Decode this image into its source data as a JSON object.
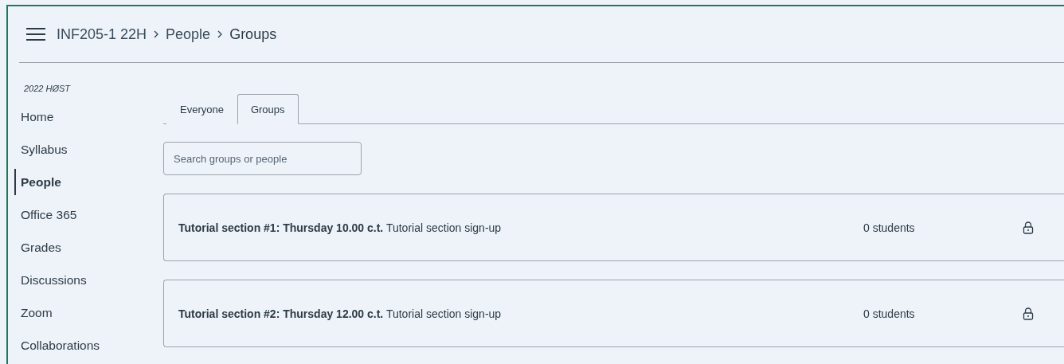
{
  "breadcrumb": [
    {
      "label": "INF205-1 22H",
      "current": false
    },
    {
      "label": "People",
      "current": false
    },
    {
      "label": "Groups",
      "current": true
    }
  ],
  "sidebar": {
    "term": "2022 HØST",
    "items": [
      {
        "label": "Home",
        "selected": false
      },
      {
        "label": "Syllabus",
        "selected": false
      },
      {
        "label": "People",
        "selected": true
      },
      {
        "label": "Office 365",
        "selected": false
      },
      {
        "label": "Grades",
        "selected": false
      },
      {
        "label": "Discussions",
        "selected": false
      },
      {
        "label": "Zoom",
        "selected": false
      },
      {
        "label": "Collaborations",
        "selected": false
      }
    ]
  },
  "tabs": [
    {
      "label": "Everyone",
      "selected": false
    },
    {
      "label": "Groups",
      "selected": true
    }
  ],
  "search": {
    "placeholder": "Search groups or people"
  },
  "groups": [
    {
      "name": "Tutorial section #1: Thursday 10.00 c.t.",
      "category": "Tutorial section sign-up",
      "count": "0 students",
      "locked": true
    },
    {
      "name": "Tutorial section #2: Thursday 12.00 c.t.",
      "category": "Tutorial section sign-up",
      "count": "0 students",
      "locked": true
    }
  ]
}
